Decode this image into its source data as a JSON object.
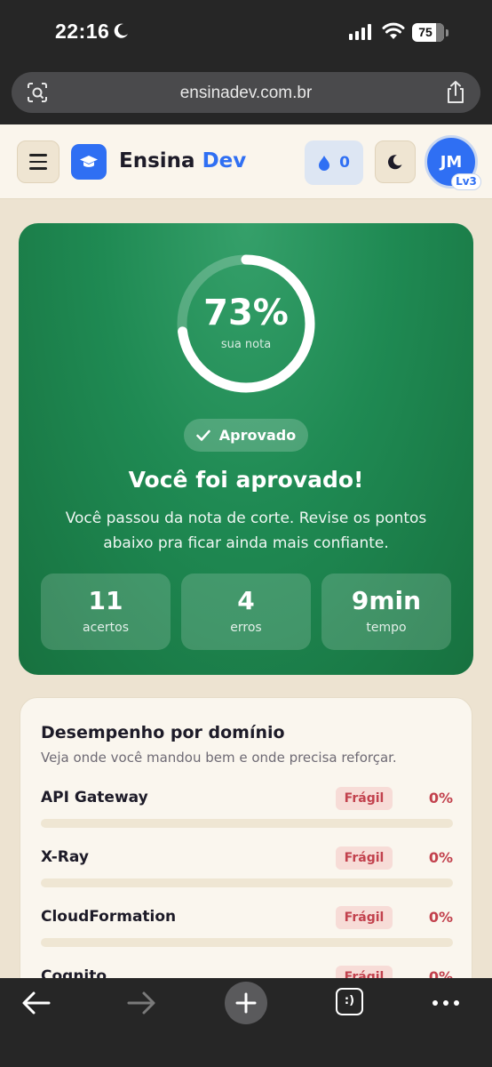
{
  "status_bar": {
    "time": "22:16",
    "battery": "75"
  },
  "browser": {
    "url": "ensinadev.com.br"
  },
  "header": {
    "brand_part1": "Ensina",
    "brand_part2": "Dev",
    "streak_count": "0",
    "avatar_initials": "JM",
    "level": "Lv3"
  },
  "result": {
    "score": "73%",
    "score_value": 0.73,
    "score_label": "sua nota",
    "badge": "Aprovado",
    "headline": "Você foi aprovado!",
    "subtext": "Você passou da nota de corte. Revise os pontos abaixo pra ficar ainda mais confiante.",
    "stats": [
      {
        "value": "11",
        "label": "acertos"
      },
      {
        "value": "4",
        "label": "erros"
      },
      {
        "value": "9min",
        "label": "tempo"
      }
    ]
  },
  "domains": {
    "title": "Desempenho por domínio",
    "subtitle": "Veja onde você mandou bem e onde precisa reforçar.",
    "items": [
      {
        "name": "API Gateway",
        "tag": "Frágil",
        "percent": "0%",
        "progress": 0
      },
      {
        "name": "X-Ray",
        "tag": "Frágil",
        "percent": "0%",
        "progress": 0
      },
      {
        "name": "CloudFormation",
        "tag": "Frágil",
        "percent": "0%",
        "progress": 0
      },
      {
        "name": "Cognito",
        "tag": "Frágil",
        "percent": "0%",
        "progress": 0
      }
    ]
  },
  "colors": {
    "brand_blue": "#2f6ff3",
    "success_green": "#1f8a53",
    "fragile_red": "#c2414d"
  },
  "icons": {
    "status": [
      "moon-icon",
      "signal-icon",
      "wifi-icon",
      "battery-icon"
    ],
    "browser": [
      "camera-search-icon",
      "share-icon"
    ],
    "header": [
      "menu-icon",
      "graduation-cap-icon",
      "drop-icon",
      "moon-icon"
    ],
    "toolbar": [
      "back-arrow-icon",
      "forward-arrow-icon",
      "plus-icon",
      "tabs-icon",
      "more-icon"
    ]
  },
  "toolbar": {
    "tabs_label": ":)"
  }
}
